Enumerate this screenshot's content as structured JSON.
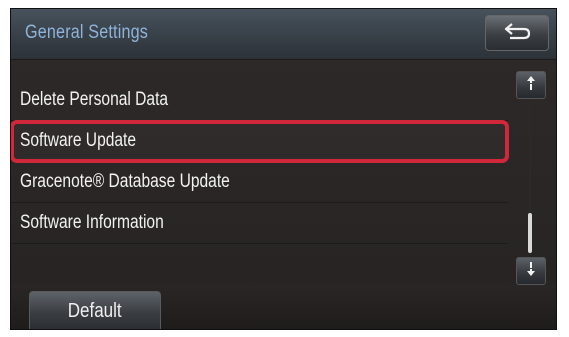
{
  "header": {
    "title": "General Settings",
    "back_icon": "return-arrow-icon"
  },
  "list": {
    "items": [
      {
        "label": "Delete Personal Data"
      },
      {
        "label": "Software Update"
      },
      {
        "label": "Gracenote® Database Update"
      },
      {
        "label": "Software Information"
      }
    ],
    "highlighted_item": "Software Update",
    "highlight_color": "#d0283a"
  },
  "scrollbar": {
    "up_icon": "scroll-up-icon",
    "down_icon": "scroll-down-icon"
  },
  "footer": {
    "default_label": "Default"
  },
  "colors": {
    "title_text": "#8fb3d9",
    "item_text": "#f2f2f2"
  }
}
